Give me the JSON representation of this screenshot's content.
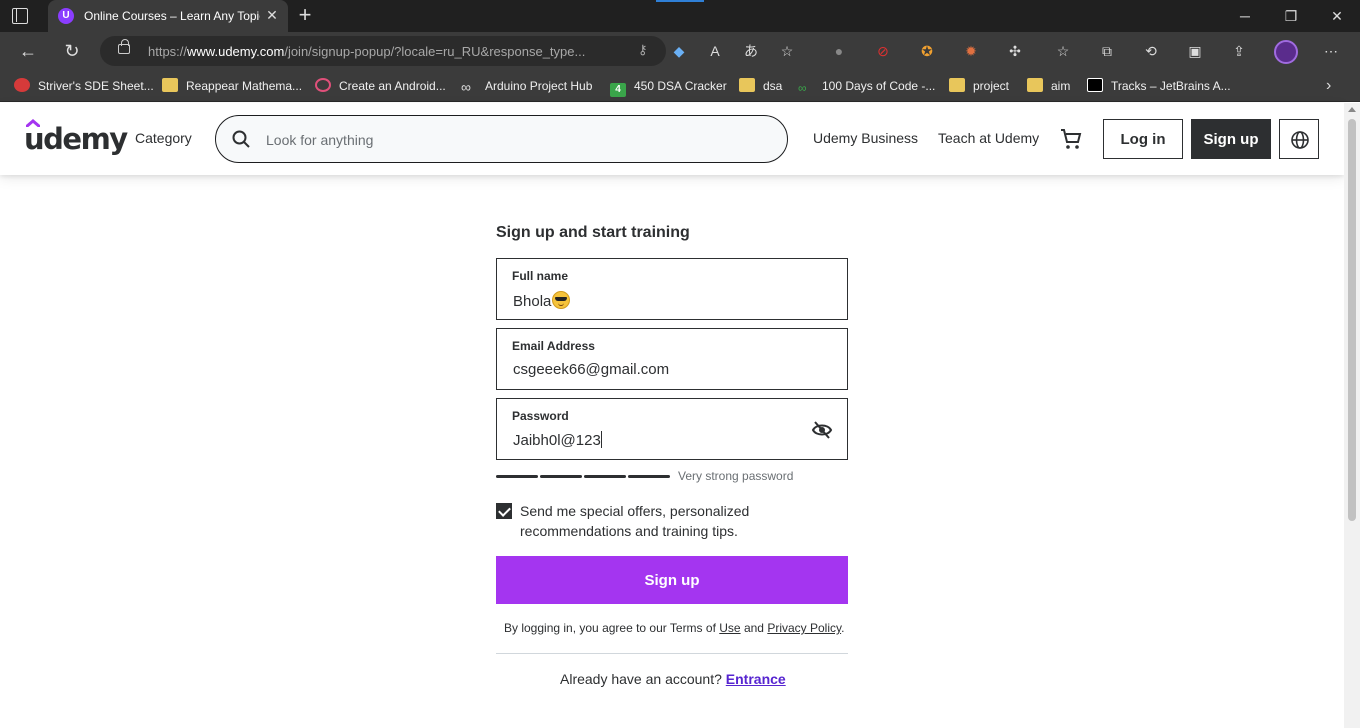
{
  "browser": {
    "tab_title": "Online Courses – Learn Any Topic",
    "tab_favicon": "U",
    "url_prefix": "https://",
    "url_domain": "www.udemy.com",
    "url_path": "/join/signup-popup/?locale=ru_RU&response_type...",
    "bookmarks": [
      {
        "label": "Striver's SDE Sheet...",
        "icon": "tuf-icon"
      },
      {
        "label": "Reappear Mathema...",
        "icon": "folder-icon"
      },
      {
        "label": "Create an Android...",
        "icon": "android-studio-icon"
      },
      {
        "label": "Arduino Project Hub",
        "icon": "arduino-icon"
      },
      {
        "label": "450 DSA Cracker",
        "icon": "four-icon"
      },
      {
        "label": "dsa",
        "icon": "folder-icon"
      },
      {
        "label": "100 Days of Code -...",
        "icon": "code-icon"
      },
      {
        "label": "project",
        "icon": "folder-icon"
      },
      {
        "label": "aim",
        "icon": "folder-icon"
      },
      {
        "label": "Tracks – JetBrains A...",
        "icon": "jetbrains-icon"
      }
    ]
  },
  "header": {
    "logo": "udemy",
    "category": "Category",
    "search_placeholder": "Look for anything",
    "business": "Udemy Business",
    "teach": "Teach at Udemy",
    "login": "Log in",
    "signup": "Sign up"
  },
  "form": {
    "heading": "Sign up and start training",
    "fullname_label": "Full name",
    "fullname_value": "Bhola",
    "email_label": "Email Address",
    "email_value": "csgeeek66@gmail.com",
    "password_label": "Password",
    "password_value": "Jaibh0l@123",
    "strength_text": "Very strong password",
    "strength_level": 4,
    "strength_max": 4,
    "offers_text": "Send me special offers, personalized recommendations and training tips.",
    "offers_checked": true,
    "submit": "Sign up",
    "terms_prefix": "By logging in, you agree to our Terms of",
    "terms_use": "Use",
    "terms_and": "and",
    "terms_privacy": "Privacy Policy",
    "terms_end": ".",
    "already_text": "Already have an account?",
    "entrance": "Entrance"
  },
  "colors": {
    "accent": "#a435f0",
    "link": "#5624d0",
    "text": "#2d2f31"
  }
}
